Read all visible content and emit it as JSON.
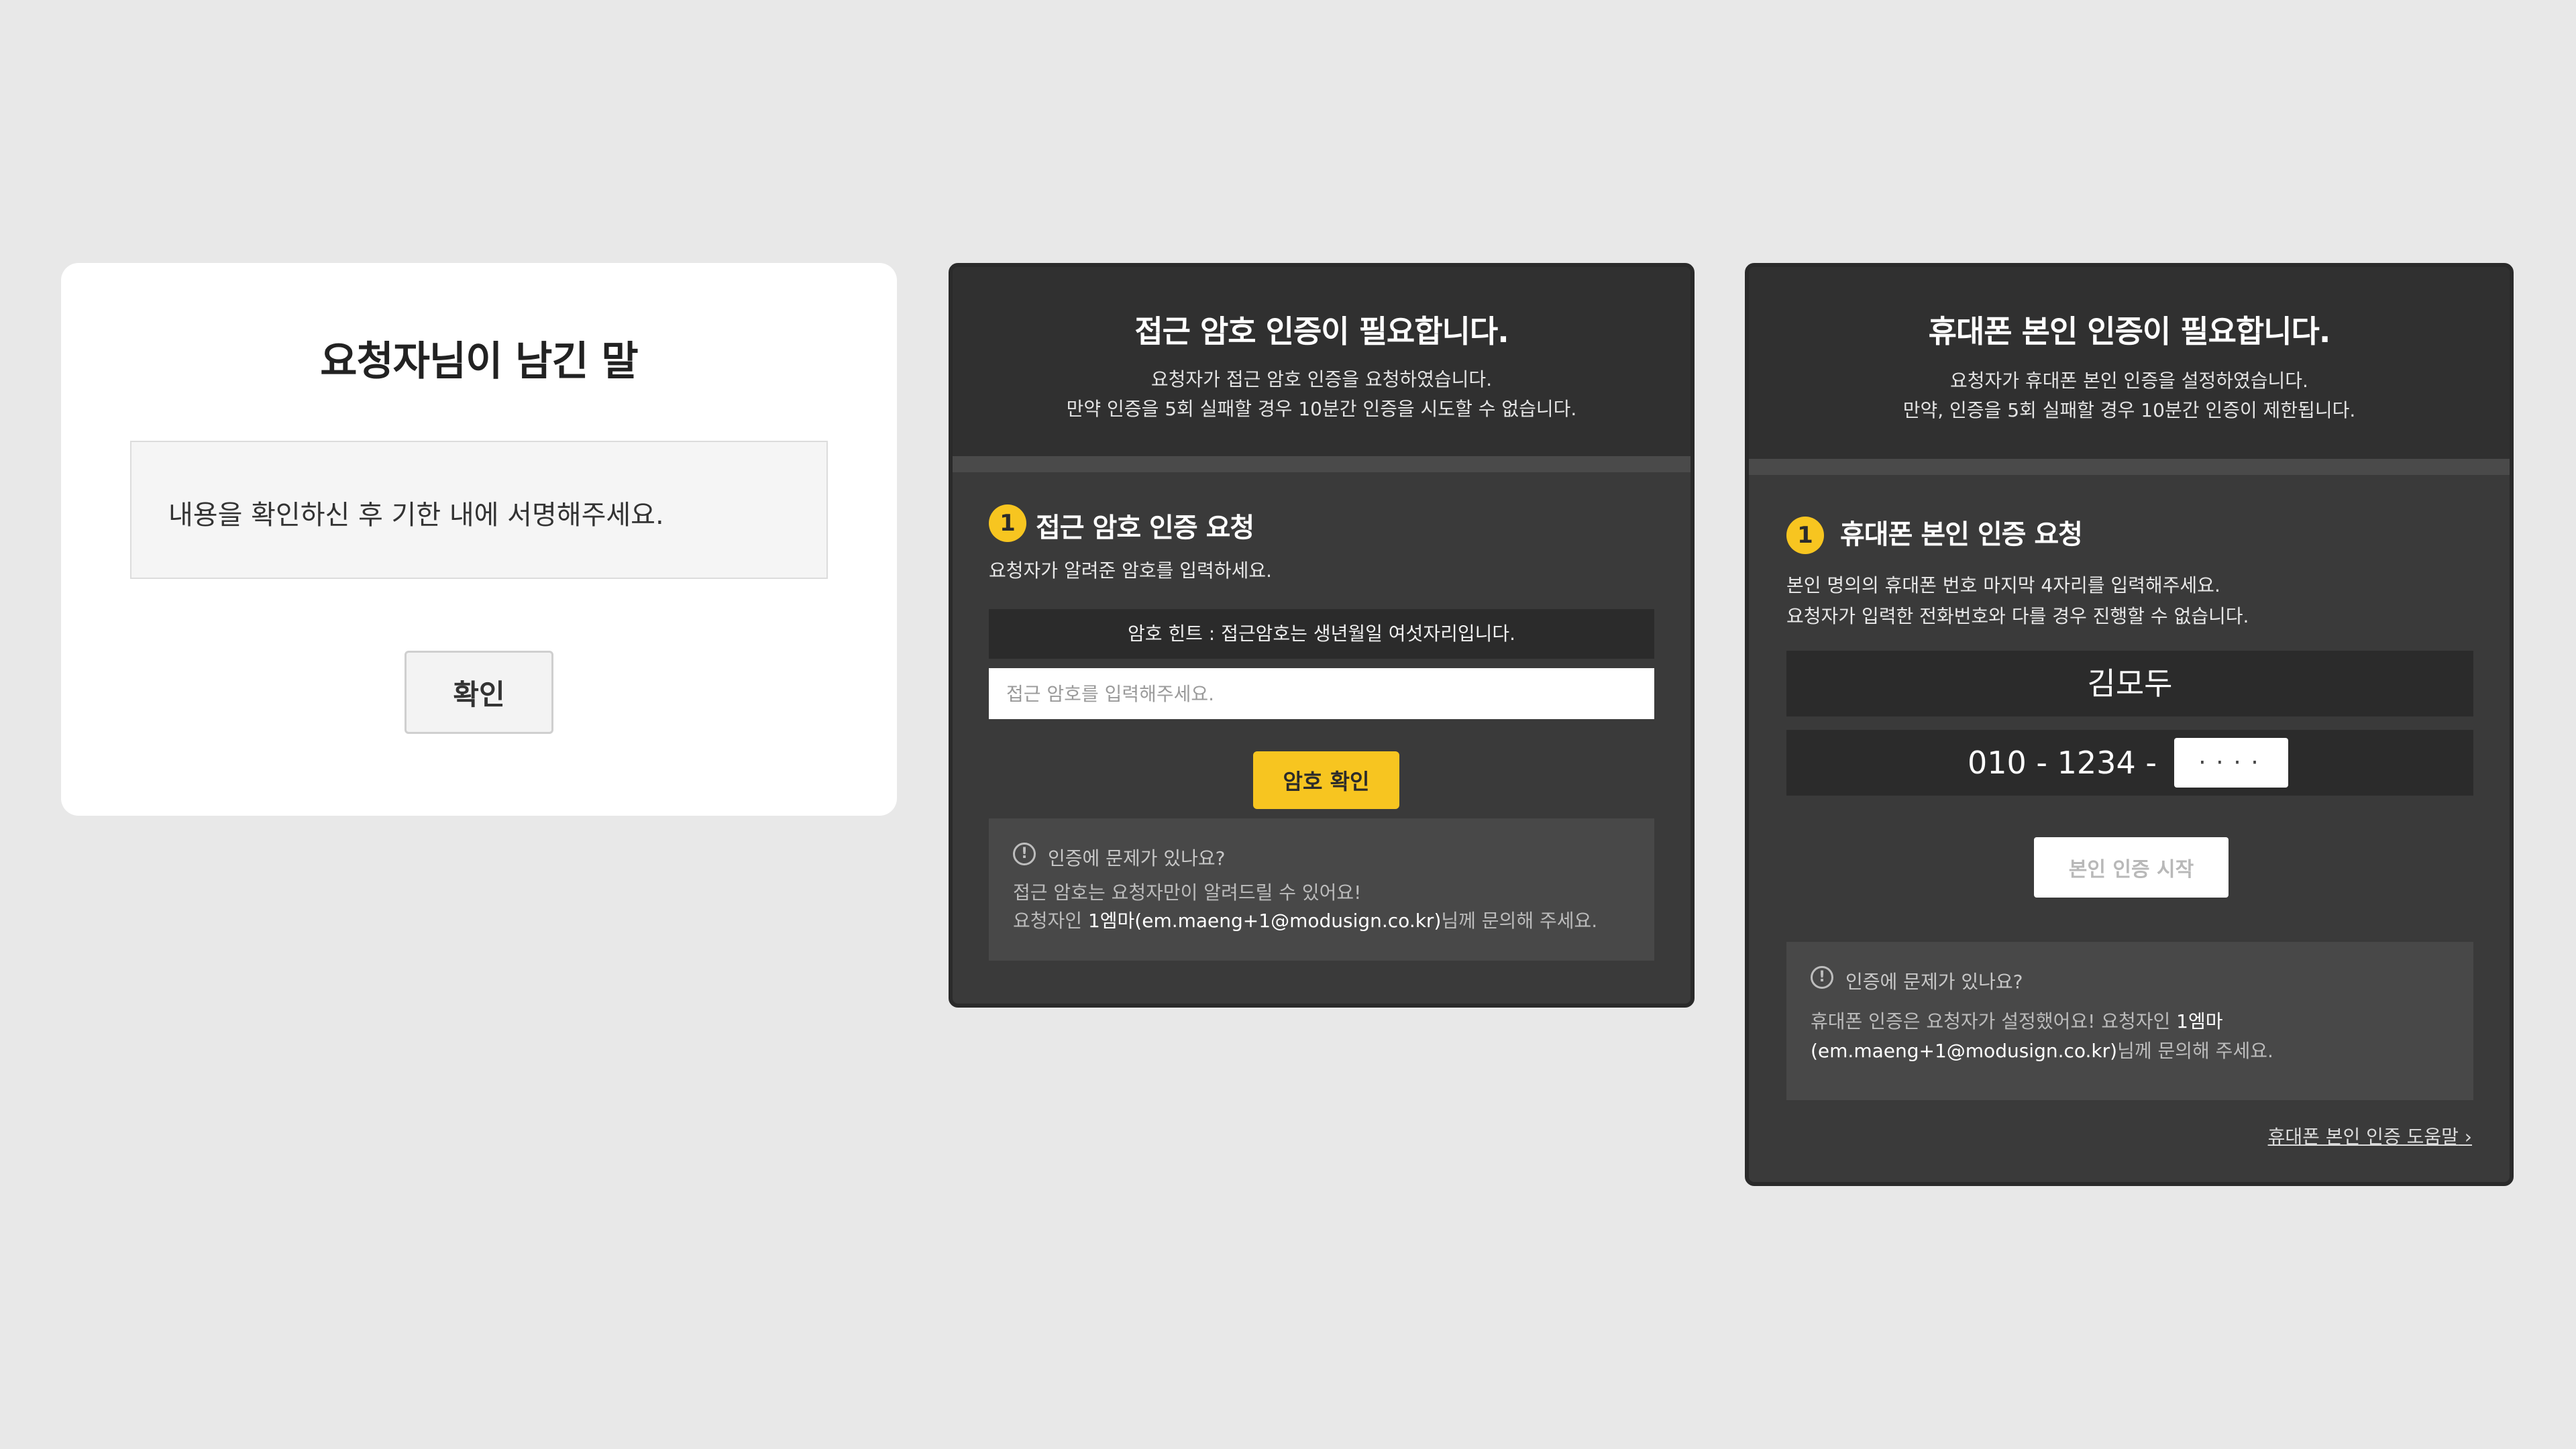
{
  "message_card": {
    "title": "요청자님이 남긴 말",
    "message": "내용을 확인하신 후 기한 내에 서명해주세요.",
    "confirm_label": "확인"
  },
  "password_card": {
    "title": "접근 암호 인증이 필요합니다.",
    "subtitle_line1": "요청자가 접근 암호 인증을 요청하였습니다.",
    "subtitle_line2": "만약 인증을 5회 실패할 경우 10분간 인증을 시도할 수 없습니다.",
    "step_number": "1",
    "step_title": "접근 암호 인증 요청",
    "instruction": "요청자가 알려준 암호를 입력하세요.",
    "hint": "암호 힌트 : 접근암호는 생년월일 여섯자리입니다.",
    "input_placeholder": "접근 암호를 입력해주세요.",
    "submit_label": "암호 확인",
    "help": {
      "title": "인증에 문제가 있나요?",
      "line1": "접근 암호는 요청자만이 알려드릴 수 있어요!",
      "line2_prefix": "요청자인 ",
      "requester": "1엠마(em.maeng+1@modusign.co.kr)",
      "line2_suffix": "님께 문의해 주세요."
    }
  },
  "phone_card": {
    "title": "휴대폰 본인 인증이 필요합니다.",
    "subtitle_line1": "요청자가 휴대폰 본인 인증을 설정하였습니다.",
    "subtitle_line2": "만약, 인증을 5회 실패할 경우 10분간 인증이 제한됩니다.",
    "step_number": "1",
    "step_title": "휴대폰 본인 인증 요청",
    "instruction_line1": "본인 명의의 휴대폰 번호 마지막 4자리를 입력해주세요.",
    "instruction_line2": "요청자가 입력한 전화번호와 다를 경우 진행할 수 없습니다.",
    "name": "김모두",
    "phone_prefix": "010 - 1234 -",
    "phone_last_value": "····",
    "start_label": "본인 인증 시작",
    "help": {
      "title": "인증에 문제가 있나요?",
      "line1_prefix": "휴대폰 인증은 요청자가 설정했어요! 요청자인 ",
      "requester_name": "1엠마",
      "requester_email": "(em.maeng+1@modusign.co.kr)",
      "line2_suffix": "님께 문의해 주세요."
    },
    "help_link": "휴대폰 본인 인증 도움말"
  },
  "colors": {
    "page_background": "#e8e8e8",
    "panel_background": "#3a3a3a",
    "panel_header": "#303030",
    "accent_yellow": "#f7c520"
  },
  "icons": {
    "help": "exclamation-circle-icon",
    "link": "chevron-right-icon"
  }
}
